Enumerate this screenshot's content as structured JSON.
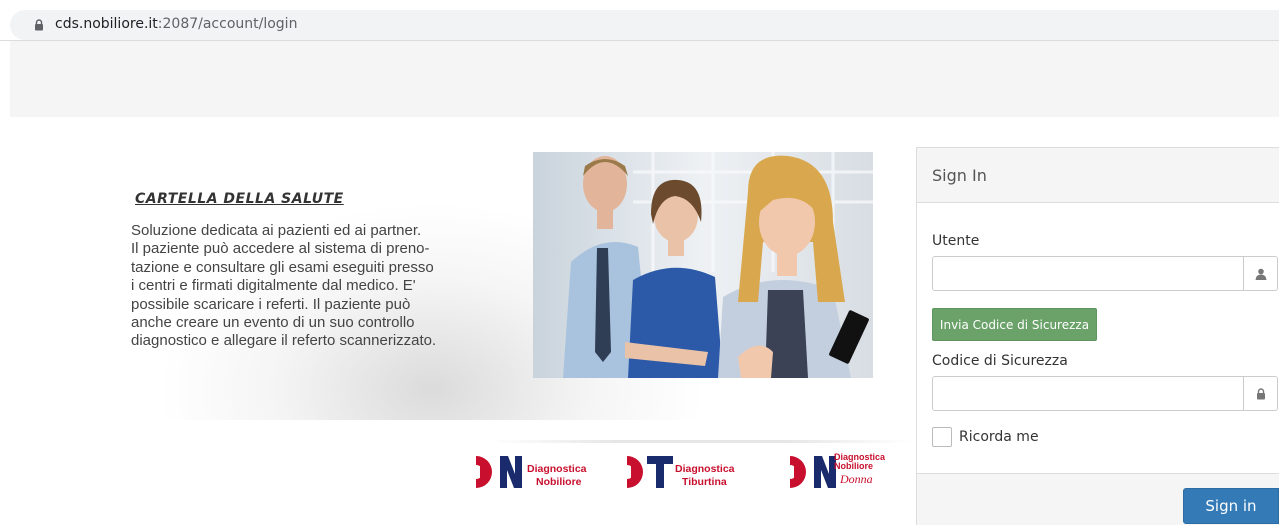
{
  "browser": {
    "url_host": "cds.nobiliore.it",
    "url_path": ":2087/account/login"
  },
  "promo": {
    "title": "CARTELLA DELLA SALUTE",
    "lines": [
      "Soluzione dedicata ai pazienti ed ai partner.",
      "Il paziente può accedere al sistema di preno-",
      "tazione e consultare gli esami eseguiti presso",
      "i centri e firmati digitalmente dal medico. E'",
      "possibile scaricare i referti. Il paziente può",
      "anche creare un evento di un suo controllo",
      "diagnostico e allegare il referto scannerizzato."
    ]
  },
  "logos": [
    {
      "mark": "DN",
      "line1": "Diagnostica",
      "line2": "Nobiliore",
      "line3": ""
    },
    {
      "mark": "DT",
      "line1": "Diagnostica",
      "line2": "Tiburtina",
      "line3": ""
    },
    {
      "mark": "DN",
      "line1": "Diagnostica",
      "line2": "Nobiliore",
      "line3": "Donna"
    }
  ],
  "signin": {
    "title": "Sign In",
    "user_label": "Utente",
    "user_value": "",
    "send_code_button": "Invia Codice di Sicurezza",
    "code_label": "Codice di Sicurezza",
    "code_value": "",
    "remember_label": "Ricorda me",
    "submit_button": "Sign in"
  },
  "colors": {
    "green_button": "#6aa26a",
    "blue_button": "#337ab7",
    "logo_navy": "#1a2b6d",
    "logo_red": "#c8102e"
  }
}
